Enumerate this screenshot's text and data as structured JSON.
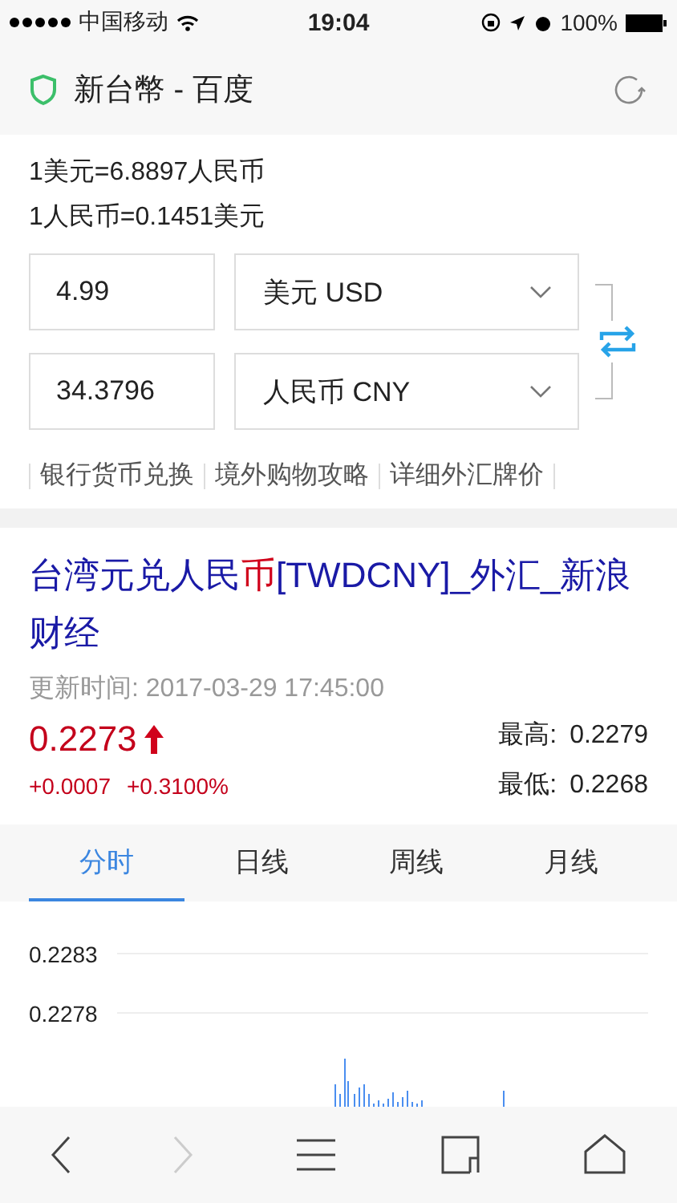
{
  "status_bar": {
    "carrier": "中国移动",
    "time": "19:04",
    "battery": "100%"
  },
  "header": {
    "title": "新台幣 - 百度"
  },
  "converter": {
    "rates": [
      "1美元=6.8897人民币",
      "1人民币=0.1451美元"
    ],
    "rows": [
      {
        "amount": "4.99",
        "currency": "美元 USD"
      },
      {
        "amount": "34.3796",
        "currency": "人民币 CNY"
      }
    ],
    "links": [
      "银行货币兑换",
      "境外购物攻略",
      "详细外汇牌价"
    ]
  },
  "result": {
    "title_parts": [
      {
        "text": "台湾元兑人民",
        "highlighted": false
      },
      {
        "text": "币",
        "highlighted": true
      },
      {
        "text": "[TWDCNY]_外汇_新浪财经",
        "highlighted": false
      }
    ],
    "updated": "更新时间: 2017-03-29 17:45:00",
    "price": "0.2273",
    "rising": true,
    "change": "+0.0007",
    "change_pct": "+0.3100%",
    "high_label": "最高:",
    "high": "0.2279",
    "low_label": "最低:",
    "low": "0.2268",
    "tabs": [
      {
        "label": "分时",
        "selected": true
      },
      {
        "label": "日线",
        "selected": false
      },
      {
        "label": "周线",
        "selected": false
      },
      {
        "label": "月线",
        "selected": false
      }
    ],
    "chart": {
      "tick_labels": [
        "0.2283",
        "0.2278"
      ]
    }
  },
  "toolbar": [
    {
      "kind": "back",
      "disabled": false
    },
    {
      "kind": "forward",
      "disabled": true
    },
    {
      "kind": "menu",
      "disabled": false
    },
    {
      "kind": "tabs",
      "disabled": false
    },
    {
      "kind": "home",
      "disabled": false
    }
  ]
}
